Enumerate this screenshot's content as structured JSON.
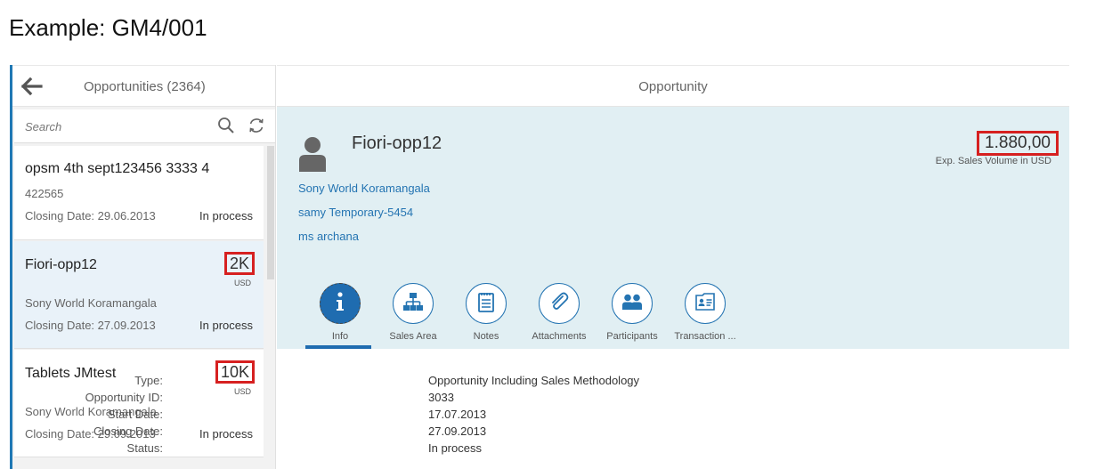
{
  "caption": "Example: GM4/001",
  "master": {
    "title": "Opportunities (2364)",
    "search_placeholder": "Search",
    "items": [
      {
        "title": "opsm 4th sept123456 3333 4",
        "subtitle": "422565",
        "closing_date": "Closing Date: 29.06.2013",
        "status": "In process",
        "amount": "",
        "currency": ""
      },
      {
        "title": "Fiori-opp12",
        "subtitle": "Sony World Koramangala",
        "closing_date": "Closing Date: 27.09.2013",
        "status": "In process",
        "amount": "2K",
        "currency": "USD"
      },
      {
        "title": "Tablets JMtest",
        "subtitle": "Sony World Koramangala",
        "closing_date": "Closing Date: 29.09.2013",
        "status": "In process",
        "amount": "10K",
        "currency": "USD"
      }
    ]
  },
  "detail": {
    "title": "Opportunity",
    "object": {
      "title": "Fiori-opp12",
      "number": "1.880,00",
      "number_unit": "Exp. Sales Volume in USD",
      "attributes": [
        "Sony World Koramangala",
        "samy Temporary-5454",
        "ms archana"
      ]
    },
    "tabs": [
      {
        "label": "Info",
        "icon": "info-icon"
      },
      {
        "label": "Sales Area",
        "icon": "hierarchy-icon"
      },
      {
        "label": "Notes",
        "icon": "notes-icon"
      },
      {
        "label": "Attachments",
        "icon": "paperclip-icon"
      },
      {
        "label": "Participants",
        "icon": "people-icon"
      },
      {
        "label": "Transaction ...",
        "icon": "business-card-icon"
      }
    ],
    "info": [
      {
        "key": "Type:",
        "value": "Opportunity Including Sales Methodology"
      },
      {
        "key": "Opportunity ID:",
        "value": "3033"
      },
      {
        "key": "Start Date:",
        "value": "17.07.2013"
      },
      {
        "key": "Closing Date:",
        "value": "27.09.2013"
      },
      {
        "key": "Status:",
        "value": "In process"
      }
    ]
  },
  "colors": {
    "accent": "#1f6cb0",
    "link": "#2474b2",
    "header_bg": "#e1eff3",
    "highlight": "#d62020"
  }
}
